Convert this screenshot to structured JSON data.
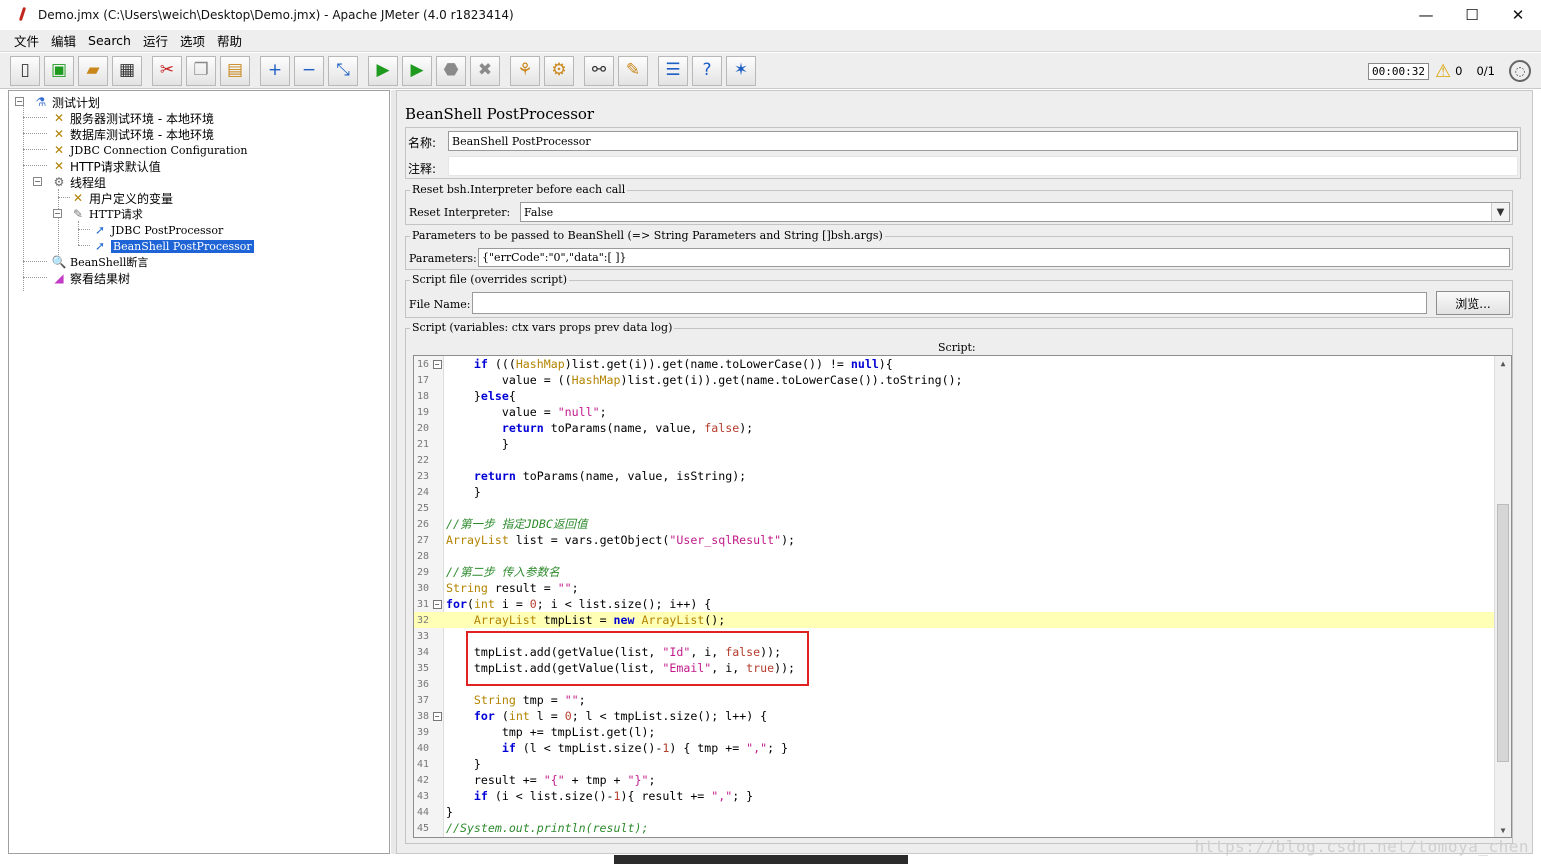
{
  "window": {
    "title": "Demo.jmx (C:\\Users\\weich\\Desktop\\Demo.jmx) - Apache JMeter (4.0 r1823414)",
    "minimize": "—",
    "maximize": "☐",
    "close": "✕"
  },
  "menu": [
    "文件",
    "编辑",
    "Search",
    "运行",
    "选项",
    "帮助"
  ],
  "toolbar_right": {
    "timer": "00:00:32",
    "count_warn": "0",
    "threads": "0/1"
  },
  "tree": [
    {
      "label": "测试计划",
      "icon": "test-plan-icon"
    },
    {
      "label": "服务器测试环境 - 本地环境",
      "icon": "config-element-icon"
    },
    {
      "label": "数据库测试环境 - 本地环境",
      "icon": "config-element-icon"
    },
    {
      "label": "JDBC Connection Configuration",
      "icon": "config-element-icon"
    },
    {
      "label": "HTTP请求默认值",
      "icon": "config-element-icon"
    },
    {
      "label": "线程组",
      "icon": "thread-group-icon"
    },
    {
      "label": "用户定义的变量",
      "icon": "config-element-icon"
    },
    {
      "label": "HTTP请求",
      "icon": "sampler-icon"
    },
    {
      "label": "JDBC PostProcessor",
      "icon": "post-processor-icon"
    },
    {
      "label": "BeanShell PostProcessor",
      "icon": "post-processor-icon",
      "selected": true
    },
    {
      "label": "BeanShell断言",
      "icon": "assertion-icon"
    },
    {
      "label": "察看结果树",
      "icon": "listener-icon"
    }
  ],
  "panel": {
    "title": "BeanShell PostProcessor",
    "name_label": "名称:",
    "name_value": "BeanShell PostProcessor",
    "comment_label": "注释:",
    "reset_group": "Reset bsh.Interpreter before each call",
    "reset_label": "Reset Interpreter:",
    "reset_value": "False",
    "params_group": "Parameters to be passed to BeanShell (=> String Parameters and String []bsh.args)",
    "params_label": "Parameters:",
    "params_value": "{\"errCode\":\"0\",\"data\":[ ]}",
    "file_group": "Script file (overrides script)",
    "file_label": "File Name:",
    "browse_label": "浏览...",
    "script_group": "Script (variables: ctx vars props prev data log)",
    "script_heading": "Script:"
  },
  "code_lines": [
    {
      "n": "16",
      "fold": true,
      "html": "    <span class=\"kw\">if</span> (((<span class=\"ty\">HashMap</span>)list.get(i)).get(name.toLowerCase()) != <span class=\"kw\">null</span>){"
    },
    {
      "n": "17",
      "fold": false,
      "html": "        value = ((<span class=\"ty\">HashMap</span>)list.get(i)).get(name.toLowerCase()).toString();"
    },
    {
      "n": "18",
      "fold": false,
      "html": "    }<span class=\"kw\">else</span>{"
    },
    {
      "n": "19",
      "fold": false,
      "html": "        value = <span class=\"st\">\"null\"</span>;"
    },
    {
      "n": "20",
      "fold": false,
      "html": "        <span class=\"kw\">return</span> toParams(name, value, <span class=\"bl\">false</span>);"
    },
    {
      "n": "21",
      "fold": false,
      "html": "        }"
    },
    {
      "n": "22",
      "fold": false,
      "html": ""
    },
    {
      "n": "23",
      "fold": false,
      "html": "    <span class=\"kw\">return</span> toParams(name, value, isString);"
    },
    {
      "n": "24",
      "fold": false,
      "html": "    }"
    },
    {
      "n": "25",
      "fold": false,
      "html": ""
    },
    {
      "n": "26",
      "fold": false,
      "html": "<span class=\"cm\">//第一步 指定JDBC返回值</span>"
    },
    {
      "n": "27",
      "fold": false,
      "html": "<span class=\"ty\">ArrayList</span> list = vars.getObject(<span class=\"st\">\"User_sqlResult\"</span>);"
    },
    {
      "n": "28",
      "fold": false,
      "html": ""
    },
    {
      "n": "29",
      "fold": false,
      "html": "<span class=\"cm\">//第二步 传入参数名</span>"
    },
    {
      "n": "30",
      "fold": false,
      "html": "<span class=\"ty\">String</span> result = <span class=\"st\">\"\"</span>;"
    },
    {
      "n": "31",
      "fold": true,
      "html": "<span class=\"kw\">for</span>(<span class=\"ty\">int</span> i = <span class=\"bl\">0</span>; i &lt; list.size(); i++) {"
    },
    {
      "n": "32",
      "fold": false,
      "hl": true,
      "html": "    <span class=\"ty\">ArrayList</span> tmpList = <span class=\"kw\">new</span> <span class=\"ty\">ArrayList</span>();"
    },
    {
      "n": "33",
      "fold": false,
      "html": ""
    },
    {
      "n": "34",
      "fold": false,
      "html": "    tmpList.add(getValue(list, <span class=\"st\">\"Id\"</span>, i, <span class=\"bl\">false</span>));"
    },
    {
      "n": "35",
      "fold": false,
      "html": "    tmpList.add(getValue(list, <span class=\"st\">\"Email\"</span>, i, <span class=\"bl\">true</span>));"
    },
    {
      "n": "36",
      "fold": false,
      "html": ""
    },
    {
      "n": "37",
      "fold": false,
      "html": "    <span class=\"ty\">String</span> tmp = <span class=\"st\">\"\"</span>;"
    },
    {
      "n": "38",
      "fold": true,
      "html": "    <span class=\"kw\">for</span> (<span class=\"ty\">int</span> l = <span class=\"bl\">0</span>; l &lt; tmpList.size(); l++) {"
    },
    {
      "n": "39",
      "fold": false,
      "html": "        tmp += tmpList.get(l);"
    },
    {
      "n": "40",
      "fold": false,
      "html": "        <span class=\"kw\">if</span> (l &lt; tmpList.size()-<span class=\"bl\">1</span>) { tmp += <span class=\"st\">\",\"</span>; }"
    },
    {
      "n": "41",
      "fold": false,
      "html": "    }"
    },
    {
      "n": "42",
      "fold": false,
      "html": "    result += <span class=\"st\">\"{\"</span> + tmp + <span class=\"st\">\"}\"</span>;"
    },
    {
      "n": "43",
      "fold": false,
      "html": "    <span class=\"kw\">if</span> (i &lt; list.size()-<span class=\"bl\">1</span>){ result += <span class=\"st\">\",\"</span>; }"
    },
    {
      "n": "44",
      "fold": false,
      "html": "}"
    },
    {
      "n": "45",
      "fold": false,
      "html": "<span class=\"cm\">//System.out.println(result);</span>"
    }
  ],
  "watermark": "https://blog.csdn.net/tomoya_chen"
}
